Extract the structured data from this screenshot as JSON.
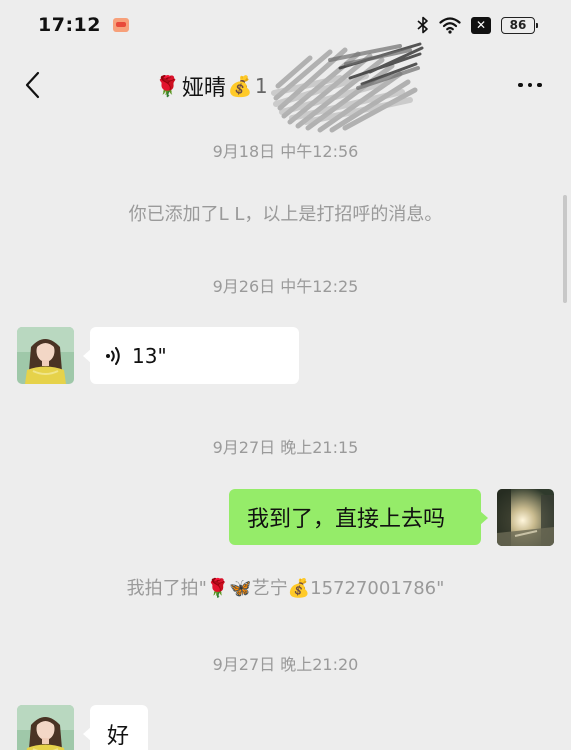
{
  "status_bar": {
    "time": "17:12",
    "battery_level": "86",
    "icons": [
      "game-app-icon",
      "bluetooth-icon",
      "wifi-icon",
      "sim-off-icon",
      "battery-icon"
    ]
  },
  "header": {
    "title_prefix_emoji": "🌹",
    "title": "娅晴",
    "title_suffix_emoji": "💰",
    "title_trail": "1",
    "back_icon": "chevron-left-icon",
    "more_icon": "more-dots-icon"
  },
  "messages": [
    {
      "type": "timestamp",
      "text": "9月18日 中午12:56"
    },
    {
      "type": "system",
      "text": "你已添加了L L，以上是打招呼的消息。"
    },
    {
      "type": "timestamp",
      "text": "9月26日 中午12:25"
    },
    {
      "type": "voice",
      "direction": "in",
      "duration": "13\""
    },
    {
      "type": "timestamp",
      "text": "9月27日 晚上21:15"
    },
    {
      "type": "text",
      "direction": "out",
      "text": "我到了，直接上去吗"
    },
    {
      "type": "system",
      "text": "我拍了拍\"🌹🦋艺宁💰15727001786\""
    },
    {
      "type": "timestamp",
      "text": "9月27日 晚上21:20"
    },
    {
      "type": "text",
      "direction": "in",
      "text": "好"
    }
  ],
  "colors": {
    "background": "#ededed",
    "outgoing_bubble": "#95ec69",
    "incoming_bubble": "#ffffff",
    "meta_text": "#9a9a9a"
  }
}
